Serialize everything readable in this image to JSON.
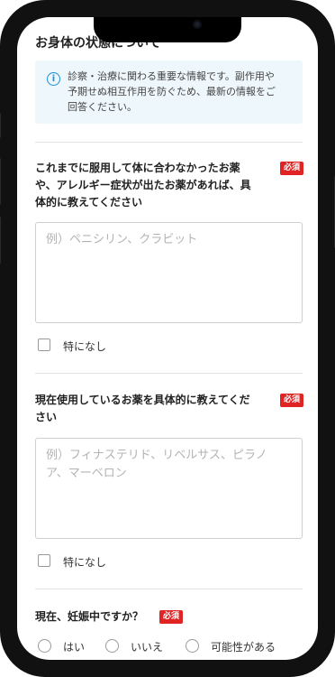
{
  "section": {
    "title": "お身体の状態について"
  },
  "notice": {
    "icon": "info-icon",
    "lines": [
      "診察・治療に関わる重要な情報です。副作用や",
      "予期せぬ相互作用を防ぐため、最新の情報をご",
      "回答ください。"
    ]
  },
  "questions": [
    {
      "lines": [
        "これまでに服用して体に合わなかったお薬",
        "や、アレルギー症状が出たお薬があれば、具",
        "体的に教えてください"
      ],
      "required": "必須",
      "placeholder_lines": [
        "例）ペニシリン、クラビット"
      ],
      "none_label": "特になし"
    },
    {
      "lines": [
        "現在使用しているお薬を具体的に教えてくだ",
        "さい"
      ],
      "required": "必須",
      "placeholder_lines": [
        "例）フィナステリド、リベルサス、ピラノ",
        "ア、マーベロン"
      ],
      "none_label": "特になし"
    },
    {
      "label": "現在、妊娠中ですか？",
      "required": "必須",
      "options": [
        "はい",
        "いいえ",
        "可能性がある"
      ]
    }
  ],
  "colors": {
    "required_badge": "#e02424",
    "notice_bg": "#eef7fb",
    "info_icon": "#1a8fd6"
  }
}
